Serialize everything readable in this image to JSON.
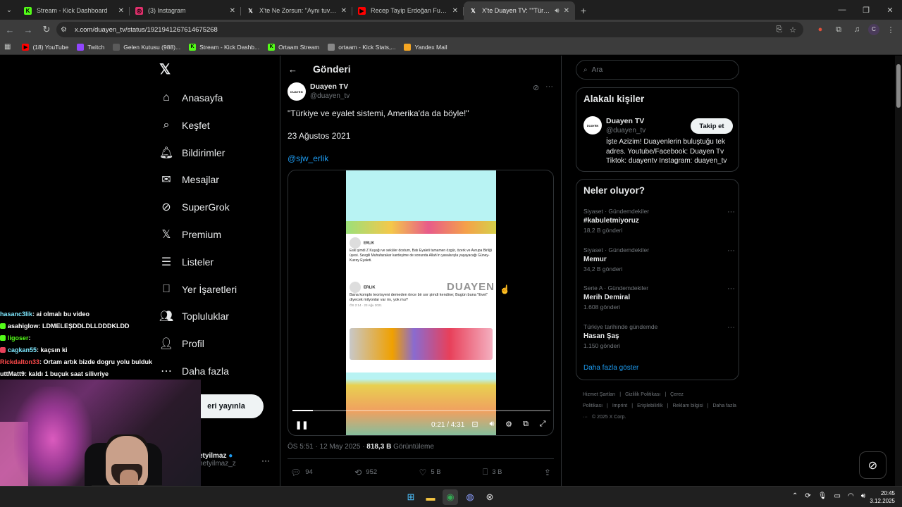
{
  "browser": {
    "tabs": [
      {
        "label": "Stream - Kick Dashboard",
        "icon": "kick-icon",
        "color": "#53fc18"
      },
      {
        "label": "(3) Instagram",
        "icon": "instagram-icon",
        "color": "#e1306c"
      },
      {
        "label": "X'te Ne Zorsun: \"Aynı tuvalete g",
        "icon": "x-icon",
        "color": "#ffffff"
      },
      {
        "label": "Recep Tayip Erdoğan Futbol (G",
        "icon": "youtube-icon",
        "color": "#ff0000"
      },
      {
        "label": "X'te Duayen TV: \"\"Türkiye v",
        "icon": "x-icon",
        "color": "#ffffff",
        "active": true
      }
    ],
    "url": "x.com/duayen_tv/status/1921941267614675268",
    "profile_letter": "C",
    "bookmarks": [
      {
        "label": "(18) YouTube",
        "color": "#ff0000",
        "icon": "youtube-icon"
      },
      {
        "label": "Twitch",
        "color": "#9146ff",
        "icon": "twitch-icon"
      },
      {
        "label": "Gelen Kutusu (988)...",
        "color": "#5a5a5a",
        "icon": "mail-icon"
      },
      {
        "label": "Stream - Kick Dashb...",
        "color": "#53fc18",
        "icon": "kick-icon"
      },
      {
        "label": "Ortaam Stream",
        "color": "#53fc18",
        "icon": "kick-icon"
      },
      {
        "label": "ortaam - Kick Stats,...",
        "color": "#888888",
        "icon": "globe-icon"
      },
      {
        "label": "Yandex Mail",
        "color": "#f5a623",
        "icon": "mail-icon"
      }
    ]
  },
  "nav": {
    "items": [
      {
        "label": "Anasayfa",
        "icon": "home-icon",
        "glyph": "⌂"
      },
      {
        "label": "Keşfet",
        "icon": "search-icon",
        "glyph": "⌕"
      },
      {
        "label": "Bildirimler",
        "icon": "bell-icon",
        "glyph": "🔔︎"
      },
      {
        "label": "Mesajlar",
        "icon": "mail-icon",
        "glyph": "✉"
      },
      {
        "label": "SuperGrok",
        "icon": "grok-icon",
        "glyph": "⊘"
      },
      {
        "label": "Premium",
        "icon": "x-logo-icon",
        "glyph": "𝕏"
      },
      {
        "label": "Listeler",
        "icon": "list-icon",
        "glyph": "☰"
      },
      {
        "label": "Yer İşaretleri",
        "icon": "bookmark-icon",
        "glyph": "⎕"
      },
      {
        "label": "Topluluklar",
        "icon": "communities-icon",
        "glyph": "👥︎"
      },
      {
        "label": "Profil",
        "icon": "profile-icon",
        "glyph": "👤︎"
      },
      {
        "label": "Daha fazla",
        "icon": "more-circle-icon",
        "glyph": "⋯"
      }
    ],
    "post_button": "eri yayınla",
    "user_name": "etyilmaz",
    "user_handle": "netyilmaz_z"
  },
  "main": {
    "title": "Gönderi",
    "author_name": "Duayen TV",
    "author_handle": "@duayen_tv",
    "avatar_text": "DUAYEN",
    "text_line1": "\"Türkiye ve eyalet sistemi, Amerika'da da böyle!\"",
    "text_line2": "23 Ağustos 2021",
    "mention": "@sjw_erlik",
    "video": {
      "watermark": "DUAYEN",
      "inner_tweet1_name": "ERLIK",
      "inner_tweet1_text": "Eski şimdi Z Kuşağı ve seküler dostum, Batı Eyaleti tamamen özgür, özerk ve Avrupa Birliği üyesi. Sevgili Muhafazakar kardeşime de sonunda Allah'ın yasalarıyla yaşayacağı Güney-Kuzey Eyaleti.",
      "inner_tweet2_name": "ERLIK",
      "inner_tweet2_text": "Bana komplo teorisyeni demeden önce bir sor şimdi kendine; Bugün buna \"Evet\" diyecek milyonlar var mı, yok mu?",
      "inner_meta": "ÖS 2:14 · 23 Ağu 2021",
      "time": "0:21 / 4:31",
      "progress": 0.078
    },
    "meta_time": "ÖS 5:51 · 12 May 2025 · ",
    "meta_views": "818,3 B",
    "meta_views_label": " Görüntüleme",
    "actions": {
      "replies": "94",
      "reposts": "952",
      "likes": "5 B",
      "bookmarks": "3 B"
    }
  },
  "sidebar": {
    "search_placeholder": "Ara",
    "related_title": "Alakalı kişiler",
    "related_name": "Duayen TV",
    "related_handle": "@duayen_tv",
    "follow_label": "Takip et",
    "related_bio": "İşte Azizim! Duayenlerin buluştuğu tek adres. Youtube/Facebook: Duayen Tv Tiktok: duayentv Instagram: duayen_tv",
    "trends_title": "Neler oluyor?",
    "trends": [
      {
        "category": "Siyaset · Gündemdekiler",
        "title": "#kabuletmiyoruz",
        "count": "18,2 B gönderi"
      },
      {
        "category": "Siyaset · Gündemdekiler",
        "title": "Memur",
        "count": "34,2 B gönderi"
      },
      {
        "category": "Serie A · Gündemdekiler",
        "title": "Merih Demiral",
        "count": "1.608 gönderi"
      },
      {
        "category": "Türkiye tarihinde gündemde",
        "title": "Hasan Şaş",
        "count": "1.150 gönderi"
      }
    ],
    "show_more": "Daha fazla göster",
    "footer_links": [
      "Hizmet Şartları",
      "|",
      "Gizlilik Politikası",
      "|",
      "Çerez Politikası",
      "|",
      "Imprint",
      "|",
      "Erişilebilirlik",
      "|",
      "Reklam bilgisi",
      "|",
      "Daha fazla ···",
      "© 2025 X Corp."
    ]
  },
  "chat": [
    {
      "user": "hasanc3lik",
      "msg": " : ai olmalı bu video",
      "color": "#7ee8ff",
      "badge": ""
    },
    {
      "user": "asahiglow",
      "msg": " : LDMELEŞDDLDLLDDDKLDD",
      "color": "#ffffff",
      "badge": "#53fc18"
    },
    {
      "user": "ligoser",
      "msg": " : ",
      "color": "#53fc18",
      "badge": "#53fc18"
    },
    {
      "user": "cagkan55",
      "msg": " : kaçsın ki",
      "color": "#7ee8ff",
      "badge": "#e8405a"
    },
    {
      "user": "Rickdalton33",
      "msg": " : Ortam artık bizde dogru yolu bulduk",
      "color": "#ff4a4a",
      "badge": ""
    },
    {
      "user": "uttMatt9",
      "msg": " : kaldı 1 buçuk saat silivriye",
      "color": "#ffffff",
      "badge": ""
    }
  ],
  "taskbar": {
    "time": "20:45",
    "date": "3.12.2025"
  }
}
